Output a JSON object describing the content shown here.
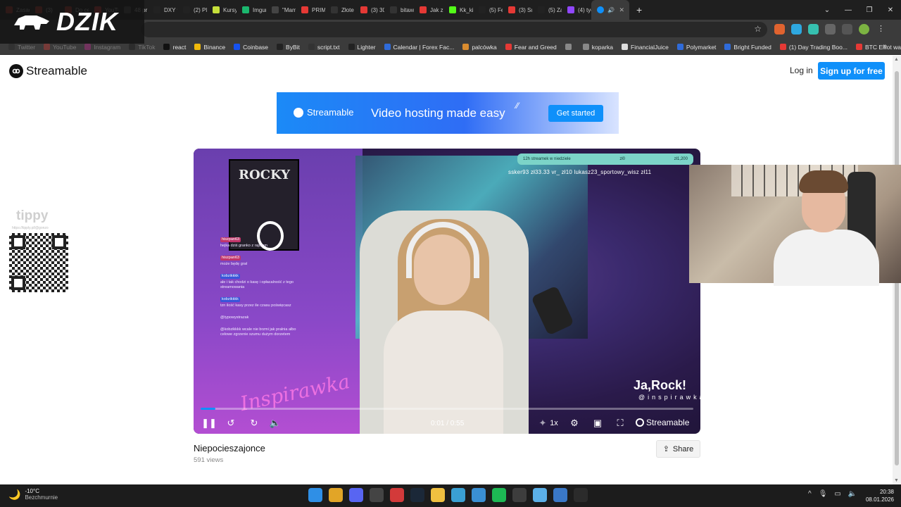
{
  "browser": {
    "tabs": [
      {
        "label": "Zasady",
        "color": "#c0392b"
      },
      {
        "label": "(3)",
        "color": "#c0392b"
      },
      {
        "label": "Do ce",
        "color": "#c0392b"
      },
      {
        "label": "YouTu",
        "color": "#e53935"
      },
      {
        "label": "48 pr",
        "color": "#555555"
      },
      {
        "label": "DXY 9",
        "color": "#222222"
      },
      {
        "label": "(2) Pl",
        "color": "#222222"
      },
      {
        "label": "Kursy",
        "color": "#c6e03b"
      },
      {
        "label": "Imgur",
        "color": "#1bb76e"
      },
      {
        "label": "\"Mam",
        "color": "#444444"
      },
      {
        "label": "PRIME",
        "color": "#e53935"
      },
      {
        "label": "Złote",
        "color": "#333333"
      },
      {
        "label": "(3) 30",
        "color": "#e53935"
      },
      {
        "label": "bitaxe",
        "color": "#333333"
      },
      {
        "label": "Jak zr",
        "color": "#e53935"
      },
      {
        "label": "Kk_kij",
        "color": "#53fc18"
      },
      {
        "label": "(5) Fe",
        "color": "#222222"
      },
      {
        "label": "(3) Su",
        "color": "#e53935"
      },
      {
        "label": "(5) Za",
        "color": "#222222"
      },
      {
        "label": "(4) tyc",
        "color": "#9147ff"
      }
    ],
    "active_tab": {
      "label": "",
      "color": "#0f90fa"
    },
    "bookmarks": [
      {
        "label": "Twitter",
        "color": "#222222",
        "faded": true
      },
      {
        "label": "YouTube",
        "color": "#e53935",
        "faded": true
      },
      {
        "label": "Instagram",
        "color": "#d6249f",
        "faded": true
      },
      {
        "label": "TikTok",
        "color": "#111111",
        "faded": true
      },
      {
        "label": "react",
        "color": "#111111"
      },
      {
        "label": "Binance",
        "color": "#f0b90b"
      },
      {
        "label": "Coinbase",
        "color": "#1652f0"
      },
      {
        "label": "ByBit",
        "color": "#222222"
      },
      {
        "label": "script.txt",
        "color": "#333333"
      },
      {
        "label": "Lighter",
        "color": "#222222"
      },
      {
        "label": "Calendar | Forex Fac...",
        "color": "#2f6bd9"
      },
      {
        "label": "palcówka",
        "color": "#d98c2f"
      },
      {
        "label": "Fear and Greed",
        "color": "#e53935"
      },
      {
        "label": "",
        "color": "#888888"
      },
      {
        "label": "koparka",
        "color": "#888888"
      },
      {
        "label": "FinancialJuice",
        "color": "#dddddd"
      },
      {
        "label": "Polymarket",
        "color": "#2f6bd9"
      },
      {
        "label": "Bright Funded",
        "color": "#2f6bd9"
      },
      {
        "label": "(1) Day Trading Boo...",
        "color": "#e53935"
      },
      {
        "label": "BTC Elliot wave",
        "color": "#e53935"
      }
    ]
  },
  "overlay": {
    "logo_text": "DZIK",
    "tippy_name": "tippy",
    "tippy_url": "https://tipply.pl/@gonzo"
  },
  "site": {
    "brand": "Streamable",
    "login_label": "Log in",
    "signup_label": "Sign up for free"
  },
  "banner": {
    "brand": "Streamable",
    "tagline": "Video hosting made easy",
    "cta": "Get started"
  },
  "video": {
    "time_label": "0:01 / 0:55",
    "progress": 0.03,
    "speed_label": "1x",
    "brand_label": "Streamable",
    "poster_title": "ROCKY",
    "tip_bar": {
      "left": "12h streamek w niedziele",
      "mid": "zł0",
      "right": "zł1,200"
    },
    "tip_line": "ssker93 zł33.33   vr_ zł10   lukasz23_sportowy_wisz zł11",
    "chat": [
      {
        "user": "hiszpan63",
        "text": "hejka dziś granko z rajotem",
        "kind": "red"
      },
      {
        "user": "hiszpan63",
        "text": "może będę grał",
        "kind": "red"
      },
      {
        "user": "kobzikkkk",
        "text": "ale i tak chodzi o kasę i opłacalność z tego streamowania",
        "kind": "blue"
      },
      {
        "user": "kobzikkkk",
        "text": "tzn ilość kasy przez ile czasu poświęcasz",
        "kind": "blue"
      },
      {
        "user": "",
        "text": "@typowystrazak",
        "kind": "plain"
      },
      {
        "user": "",
        "text": "@kobzikkkk wcale nie brzmi jak pralnia albo celowe zgrzenie szumu dużym dorzetem",
        "kind": "plain"
      }
    ],
    "watermark": "Ja,Rock!",
    "watermark_handle": "@inspirawka",
    "overlay_script": "Inspirawka",
    "title": "Niepocieszajonce",
    "views": "591 views",
    "share_label": "Share"
  },
  "taskbar": {
    "temperature": "-10°C",
    "weather": "Bezchmurnie",
    "time": "20:38",
    "date": "08.01.2026",
    "apps": [
      {
        "name": "windows",
        "color": "#2f8fe6"
      },
      {
        "name": "chrome",
        "color": "#e2a527"
      },
      {
        "name": "discord",
        "color": "#5865f2"
      },
      {
        "name": "app",
        "color": "#444444"
      },
      {
        "name": "app",
        "color": "#d33a3a"
      },
      {
        "name": "steam",
        "color": "#1b2838"
      },
      {
        "name": "explorer",
        "color": "#f0c040"
      },
      {
        "name": "app",
        "color": "#3aa0d3"
      },
      {
        "name": "app",
        "color": "#3a8fd3"
      },
      {
        "name": "spotify",
        "color": "#1db954"
      },
      {
        "name": "app",
        "color": "#3d3d3d"
      },
      {
        "name": "notepad",
        "color": "#5bb0e8"
      },
      {
        "name": "app",
        "color": "#3a78c8"
      },
      {
        "name": "terminal",
        "color": "#2b2b2b"
      }
    ]
  }
}
